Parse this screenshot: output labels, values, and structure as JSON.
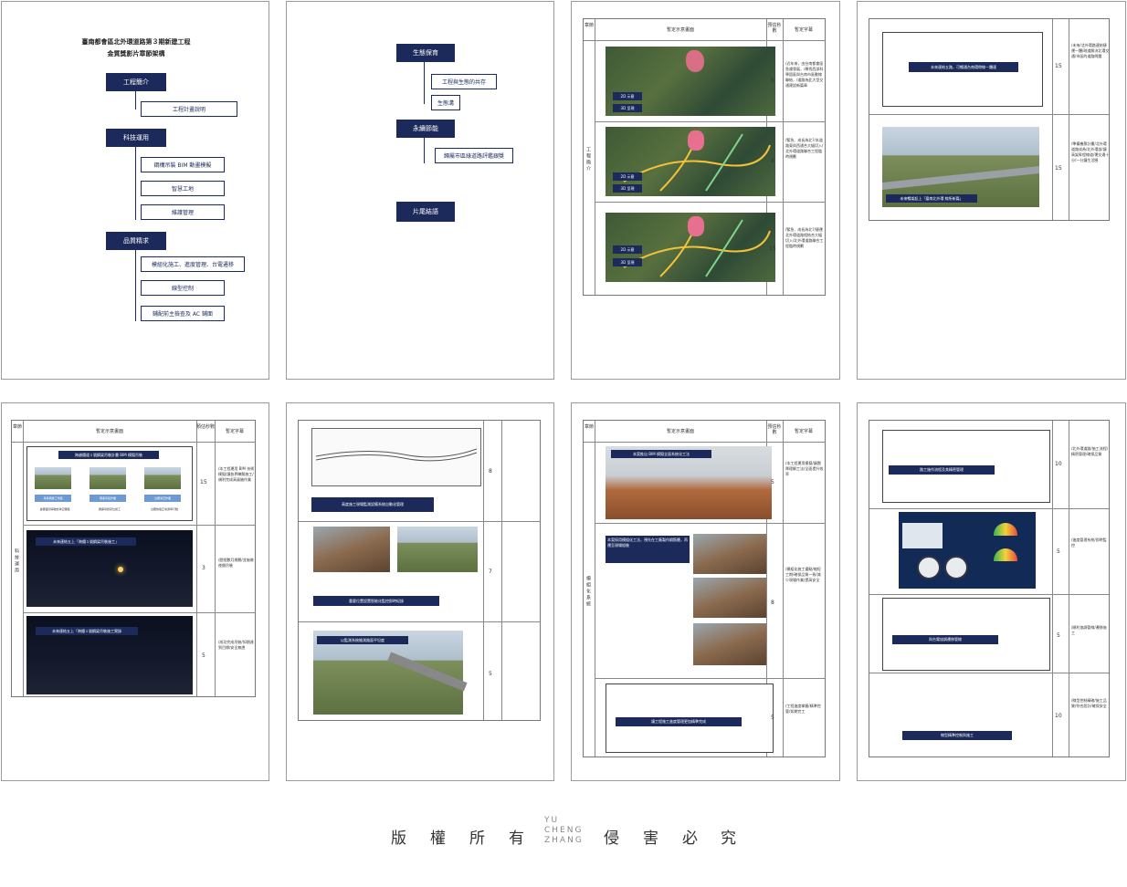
{
  "page1": {
    "title_line1": "臺南都會區北外環道路第３期新建工程",
    "title_line2": "金質獎影片章節架構",
    "sections": [
      {
        "label": "工程簡介",
        "items": [
          "工程計畫說明"
        ]
      },
      {
        "label": "科技運用",
        "items": [
          "鋼構吊裝 BIM 動畫模擬",
          "智慧工地",
          "維護管理"
        ]
      },
      {
        "label": "品質精求",
        "items": [
          "模組化施工、進度管理、台電遷移",
          "線型控制",
          "鋪配前主檢查及 AC 鋪面"
        ]
      }
    ]
  },
  "page2": {
    "sections": [
      {
        "label": "生態保育",
        "items": [
          "工程與生態的共存",
          "生態溝"
        ]
      },
      {
        "label": "永續節能",
        "items": [
          "歸屬市區綠道路評鑑銀獎"
        ]
      },
      {
        "label": "片尾結語",
        "items": []
      }
    ]
  },
  "table_headers": {
    "chapter": "章節",
    "scene": "暫定示意畫面",
    "time": "預估秒數",
    "caption": "暫定字幕"
  },
  "page3": {
    "chapter": "工程簡介",
    "rows": [
      {
        "badges": [
          "2D 示意",
          "3D 呈現"
        ],
        "seconds": "5",
        "notes": "/近年來，由台南都會區急遽發展，/尋找西部科學園區與台南市區動線聯結，/道路為此大型交通建設新篇章"
      },
      {
        "badges": [
          "2D 示意",
          "3D 呈現"
        ],
        "seconds": "8",
        "notes": "/緊急、成長為北?/本道路東與西通合大幅切入/北外環道路聯合工程臨時規劃"
      },
      {
        "badges": [
          "2D 示意",
          "3D 呈現"
        ],
        "seconds": "15",
        "notes": "/緊急、成長為北?/捷運北外環道路相結合大幅切入/北外環道路聯合工程臨時規劃"
      }
    ]
  },
  "page4": {
    "rows": [
      {
        "caption": "未來連結五路，可暢通台南環帶線一體連",
        "seconds": "15",
        "notes": "/未來/北外環路連結捷運一體/疏道解決北環交通/市區的道路問題"
      },
      {
        "caption": "未來暢架起上「臺南北外環 線所新篇」",
        "seconds": "15",
        "notes": "/準備機票計畫/北外環道路成為/北外環部/讓高架幹程線道/運交通十分/一分鐘生活圈"
      }
    ]
  },
  "page5": {
    "chapter": "科技運用",
    "rows": [
      {
        "caption": "跨越鐵道１號鋼梁吊裝計畫 BIM 模擬吊裝",
        "sub_labels": [
          "吊掛鋼梁工作面",
          "鋼梁吊裝作業",
          "台鐵淨空作業"
        ],
        "tiny": [
          "臺鐵夜間停駛前淨空鐵路",
          "鋼梁吊掛就位施工",
          "台鐵恢復正常通車行駛"
        ],
        "seconds": "15",
        "notes": "/本工程運用 BIM 技術模擬/讓各界瞭解施工/順利完成高風險作業"
      },
      {
        "caption": "未來連結五上「跨鐵１號鋼梁吊裝施工」",
        "seconds": "3",
        "notes": "/歷經數月規劃/並施做夜間吊裝"
      },
      {
        "caption": "未來連結五上「跨鐵１號鋼梁吊裝施工實錄",
        "seconds": "5",
        "notes": "/成功完成吊裝/如期達到目標/安全無虞"
      }
    ]
  },
  "page6": {
    "rows": [
      {
        "caption": "",
        "seconds": "8"
      },
      {
        "caption": "高度施工現場監測設備系統自動化管理",
        "seconds": "",
        "notes": ""
      },
      {
        "caption": "重要位置設置智能化監控即時紀錄",
        "seconds": "7"
      },
      {
        "caption": "以監測系統檢測路面平坦度",
        "seconds": "5"
      }
    ]
  },
  "page7": {
    "chapter": "模組化系統",
    "rows": [
      {
        "caption": "本案推出 BIM 模擬全面系統化工法",
        "seconds": "5",
        "notes": "/本工程運用模擬/讓團隊理解工法/全面提升效率"
      },
      {
        "caption": "本案採用模組化工法，預先在工廠製作鋼筋籠，再運至現場組裝",
        "seconds": "8",
        "notes": "/模組化施工優點/縮短工期/確保品質一致/減少現場作業/提高安全"
      },
      {
        "caption": "讓工程施工進度管理更加精準完成",
        "seconds": "5",
        "notes": "/工程進度掌握/精準控管/如期完工"
      }
    ]
  },
  "page8": {
    "rows": [
      {
        "caption": "路工施作流程及其精密管理",
        "seconds": "10",
        "notes": "/北外環道路/施工流程/精密管理/確保品質"
      },
      {
        "caption": "",
        "seconds": "5",
        "notes": "/進度管理系統/即時監控"
      },
      {
        "caption": "與台電協調遷移管線",
        "seconds": "5",
        "notes": "/順利協調管線/遷移施工"
      },
      {
        "caption": "線型精準控制與施工",
        "seconds": "10",
        "notes": "/線型控制精確/施工品質/符合設計/確保安全"
      }
    ]
  },
  "footer": {
    "chars": [
      "版",
      "權",
      "所",
      "有",
      "侵",
      "害",
      "必",
      "究"
    ],
    "logo_lines": [
      "YU",
      "CHENG",
      "ZHANG"
    ]
  },
  "colors": {
    "navy": "#1b2a5a",
    "border": "#9a9a9a"
  }
}
